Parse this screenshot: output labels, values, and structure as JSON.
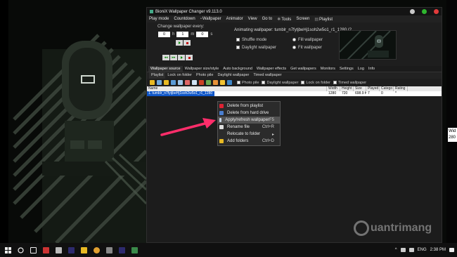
{
  "window": {
    "title": "BioniX Wallpaper Changer v9.113.0"
  },
  "menu": [
    {
      "label": "Play mode"
    },
    {
      "label": "Countdown"
    },
    {
      "label": "Wallpaper",
      "icon": "wallpaper-icon"
    },
    {
      "label": "Animator"
    },
    {
      "label": "View"
    },
    {
      "label": "Go to"
    },
    {
      "label": "Tools",
      "icon": "tools-icon"
    },
    {
      "label": "Screen"
    },
    {
      "label": "Playlist",
      "icon": "playlist-icon"
    }
  ],
  "top_panel": {
    "change_label": "Change wallpaper every:",
    "spinners": [
      {
        "value": "0",
        "unit": "h"
      },
      {
        "value": "1",
        "unit": "m"
      },
      {
        "value": "0",
        "unit": "s"
      }
    ],
    "animating_text": "Animating wallpaper: tumblr_n7fytjbeHj1soh2w5o1_r1_1280 (2",
    "options_left": [
      "Shuffle mode",
      "Daylight wallpaper"
    ],
    "options_right": [
      "Fill wallpaper",
      "Fit wallpaper"
    ]
  },
  "tabs": [
    "Wallpaper source",
    "Wallpaper size/style",
    "Auto background",
    "Wallpaper effects",
    "Get wallpapers",
    "Monitors",
    "Settings",
    "Log",
    "Info"
  ],
  "subtabs": [
    "Playlist",
    "Lock on folder",
    "Photo pile",
    "Daylight wallpaper",
    "Timed wallpaper"
  ],
  "toolbar_checks": [
    "Photo pile",
    "Daylight wallpaper",
    "Lock on folder",
    "Timed wallpaper"
  ],
  "list": {
    "columns": [
      "Name",
      "Width",
      "Height",
      "Size",
      "Played",
      "Catego",
      "Rating"
    ],
    "rows": [
      {
        "name": "1. tumblr_n7fytjbeHj1soh2w5o1_r1_1280",
        "width": "1280",
        "height": "720",
        "size": "698.9 KB",
        "played": "7",
        "category": "0",
        "rating": "*"
      }
    ]
  },
  "context_menu": [
    {
      "label": "Delete from playlist",
      "key": "",
      "icon": "delete-icon"
    },
    {
      "label": "Delete from hard drive",
      "key": "",
      "icon": "delete-drive-icon"
    },
    {
      "label": "Apply/refresh wallpaper",
      "key": "F5",
      "icon": "apply-icon",
      "highlighted": true
    },
    {
      "label": "Rename file",
      "key": "Ctrl+R",
      "icon": "rename-icon"
    },
    {
      "label": "Relocate to folder",
      "key": "▸",
      "icon": ""
    },
    {
      "label": "Add folders",
      "key": "Ctrl+D",
      "icon": "folder-icon"
    }
  ],
  "watermark": {
    "text": "uantrimang"
  },
  "right_widget": {
    "line1": "Wid",
    "line2": "280"
  },
  "taskbar": {
    "lang": "ENG",
    "time": "2:38 PM"
  },
  "colors": {
    "selection": "#0f56c8",
    "arrow": "#ff2d6a",
    "play": "#0b8a0b",
    "stop": "#c01010"
  }
}
